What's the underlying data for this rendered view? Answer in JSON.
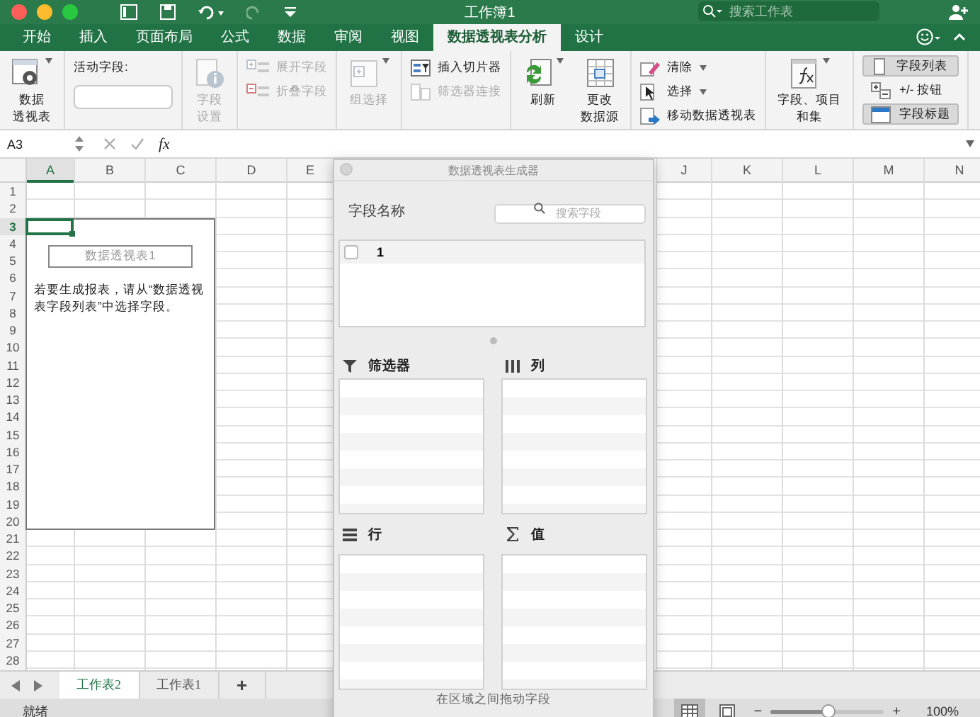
{
  "window": {
    "title": "工作簿1",
    "search": {
      "placeholder": "搜索工作表"
    }
  },
  "ribbon_tabs": [
    {
      "label": "开始",
      "selected": false
    },
    {
      "label": "插入",
      "selected": false
    },
    {
      "label": "页面布局",
      "selected": false
    },
    {
      "label": "公式",
      "selected": false
    },
    {
      "label": "数据",
      "selected": false
    },
    {
      "label": "审阅",
      "selected": false
    },
    {
      "label": "视图",
      "selected": false
    },
    {
      "label": "数据透视表分析",
      "selected": true
    },
    {
      "label": "设计",
      "selected": false
    }
  ],
  "ribbon": {
    "groups": [
      {
        "items": [
          {
            "kind": "large",
            "lines": [
              "数据",
              "透视表"
            ],
            "dropdown": true,
            "disabled": false
          }
        ]
      },
      {
        "items": [
          {
            "kind": "field",
            "label": "活动字段:"
          }
        ]
      },
      {
        "items": [
          {
            "kind": "large",
            "lines": [
              "字段",
              "设置"
            ],
            "dropdown": false,
            "disabled": true
          }
        ]
      },
      {
        "items": [
          {
            "kind": "small",
            "label": "展开字段",
            "dropdown": false,
            "disabled": true
          },
          {
            "kind": "small",
            "label": "折叠字段",
            "dropdown": false,
            "disabled": true
          }
        ]
      },
      {
        "items": [
          {
            "kind": "large",
            "lines": [
              "组选择"
            ],
            "dropdown": true,
            "disabled": true
          }
        ]
      },
      {
        "items": [
          {
            "kind": "small",
            "label": "插入切片器",
            "dropdown": false,
            "disabled": false
          },
          {
            "kind": "small",
            "label": "筛选器连接",
            "dropdown": false,
            "disabled": true
          }
        ]
      },
      {
        "items": [
          {
            "kind": "large",
            "lines": [
              "刷新"
            ],
            "dropdown": true,
            "disabled": false
          },
          {
            "kind": "large",
            "lines": [
              "更改",
              "数据源"
            ],
            "dropdown": false,
            "disabled": false
          }
        ]
      },
      {
        "items": [
          {
            "kind": "small",
            "label": "清除",
            "dropdown": true,
            "disabled": false
          },
          {
            "kind": "small",
            "label": "选择",
            "dropdown": true,
            "disabled": false
          },
          {
            "kind": "small",
            "label": "移动数据透视表",
            "dropdown": false,
            "disabled": false
          }
        ]
      },
      {
        "items": [
          {
            "kind": "large",
            "lines": [
              "字段、项目",
              "和集"
            ],
            "dropdown": true,
            "disabled": false
          }
        ]
      },
      {
        "items": [
          {
            "kind": "toggle",
            "label": "字段列表",
            "selected": true
          },
          {
            "kind": "toggle",
            "label": "+/- 按钮",
            "selected": false
          },
          {
            "kind": "toggle",
            "label": "字段标题",
            "selected": true
          }
        ]
      }
    ]
  },
  "formula_bar": {
    "name_box": "A3",
    "fx": "fx"
  },
  "sheet": {
    "columns": [
      {
        "label": "A",
        "selected": true
      },
      {
        "label": "B",
        "selected": false
      },
      {
        "label": "C",
        "selected": false
      },
      {
        "label": "D",
        "selected": false
      },
      {
        "label": "E",
        "selected": false
      },
      {
        "label": "J",
        "selected": false
      },
      {
        "label": "K",
        "selected": false
      },
      {
        "label": "L",
        "selected": false
      },
      {
        "label": "M",
        "selected": false
      },
      {
        "label": "N",
        "selected": false
      }
    ],
    "rows": [
      {
        "label": "1",
        "selected": false
      },
      {
        "label": "2",
        "selected": false
      },
      {
        "label": "3",
        "selected": true
      },
      {
        "label": "4",
        "selected": false
      },
      {
        "label": "5",
        "selected": false
      },
      {
        "label": "6",
        "selected": false
      },
      {
        "label": "7",
        "selected": false
      },
      {
        "label": "8",
        "selected": false
      },
      {
        "label": "9",
        "selected": false
      },
      {
        "label": "10",
        "selected": false
      },
      {
        "label": "11",
        "selected": false
      },
      {
        "label": "12",
        "selected": false
      },
      {
        "label": "13",
        "selected": false
      },
      {
        "label": "14",
        "selected": false
      },
      {
        "label": "15",
        "selected": false
      },
      {
        "label": "16",
        "selected": false
      },
      {
        "label": "17",
        "selected": false
      },
      {
        "label": "18",
        "selected": false
      },
      {
        "label": "19",
        "selected": false
      },
      {
        "label": "20",
        "selected": false
      },
      {
        "label": "21",
        "selected": false
      },
      {
        "label": "22",
        "selected": false
      },
      {
        "label": "23",
        "selected": false
      },
      {
        "label": "24",
        "selected": false
      },
      {
        "label": "25",
        "selected": false
      },
      {
        "label": "26",
        "selected": false
      },
      {
        "label": "27",
        "selected": false
      },
      {
        "label": "28",
        "selected": false
      }
    ],
    "pivot_placeholder": {
      "title": "数据透视表1",
      "hint": "若要生成报表，请从“数据透视表字段列表”中选择字段。"
    }
  },
  "sheet_tabs": [
    {
      "label": "工作表2",
      "selected": true
    },
    {
      "label": "工作表1",
      "selected": false
    }
  ],
  "add_sheet": "+",
  "status_bar": {
    "status": "就绪",
    "views": [
      {
        "selected": true
      },
      {
        "selected": false
      }
    ],
    "zoom_out": "−",
    "zoom": {
      "level": 0.51
    },
    "zoom_in": "+",
    "zoom_reading": "100%"
  },
  "pivot_builder": {
    "title": "数据透视表生成器",
    "fields_label": "字段名称",
    "search": {
      "placeholder": "搜索字段"
    },
    "fields": [
      {
        "label": "1",
        "checked": false
      }
    ],
    "areas": [
      {
        "kind": "filters",
        "label": "筛选器"
      },
      {
        "kind": "columns",
        "label": "列"
      },
      {
        "kind": "rows",
        "label": "行"
      },
      {
        "kind": "values",
        "label": "值"
      }
    ],
    "hint": "在区域之间拖动字段"
  }
}
